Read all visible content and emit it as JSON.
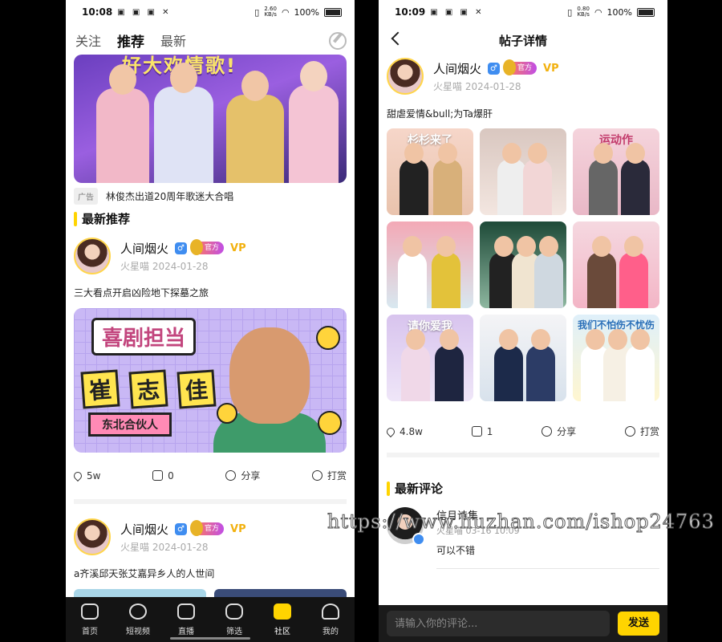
{
  "left": {
    "status": {
      "time": "10:08",
      "net": "2.60\nKB/s",
      "battery": "100%"
    },
    "tabs": [
      "关注",
      "推荐",
      "最新"
    ],
    "banner": {
      "title": "好大欢情歌!"
    },
    "ad": {
      "tag": "广告",
      "text": "林俊杰出道20周年歌迷大合唱"
    },
    "section_title": "最新推荐",
    "post1": {
      "user": "人间烟火",
      "gender": "♂",
      "badge": "官方",
      "vip": "VP",
      "sub": "火星喵 2024-01-28",
      "text": "三大看点开启凶险地下探墓之旅",
      "promo": {
        "top": "喜剧担当",
        "name": [
          "崔",
          "志",
          "佳"
        ],
        "sub": "东北合伙人"
      },
      "actions": {
        "likes": "5w",
        "comments": "0",
        "share": "分享",
        "tip": "打赏"
      }
    },
    "post2": {
      "user": "人间烟火",
      "gender": "♂",
      "badge": "官方",
      "vip": "VP",
      "sub": "火星喵 2024-01-28",
      "text": "a齐溪邱天张艾嘉异乡人的人世间"
    },
    "tabbar": [
      "首页",
      "短视频",
      "直播",
      "筛选",
      "社区",
      "我的"
    ]
  },
  "right": {
    "status": {
      "time": "10:09",
      "net": "0.80\nKB/s",
      "battery": "100%"
    },
    "header_title": "帖子详情",
    "post": {
      "user": "人间烟火",
      "gender": "♂",
      "badge": "官方",
      "vip": "VP",
      "sub": "火星喵 2024-01-28",
      "text": "甜虐爱情&bull;为Ta爆肝",
      "grid_titles": [
        "杉杉来了",
        "",
        "运动作",
        "",
        "",
        "",
        "请你爱我",
        "",
        "我们不怕伤不忧伤"
      ],
      "actions": {
        "likes": "4.8w",
        "comments": "1",
        "share": "分享",
        "tip": "打赏"
      }
    },
    "comments_title": "最新评论",
    "comment": {
      "name": "信月诗集",
      "meta": "火星喵    03-16 10:09",
      "text": "可以不错"
    },
    "input_placeholder": "请输入你的评论...",
    "send_label": "发送"
  },
  "watermark": "https://www.huzhan.com/ishop24763",
  "colors": {
    "accent": "#ffd400",
    "gender_blue": "#3f8df0"
  }
}
